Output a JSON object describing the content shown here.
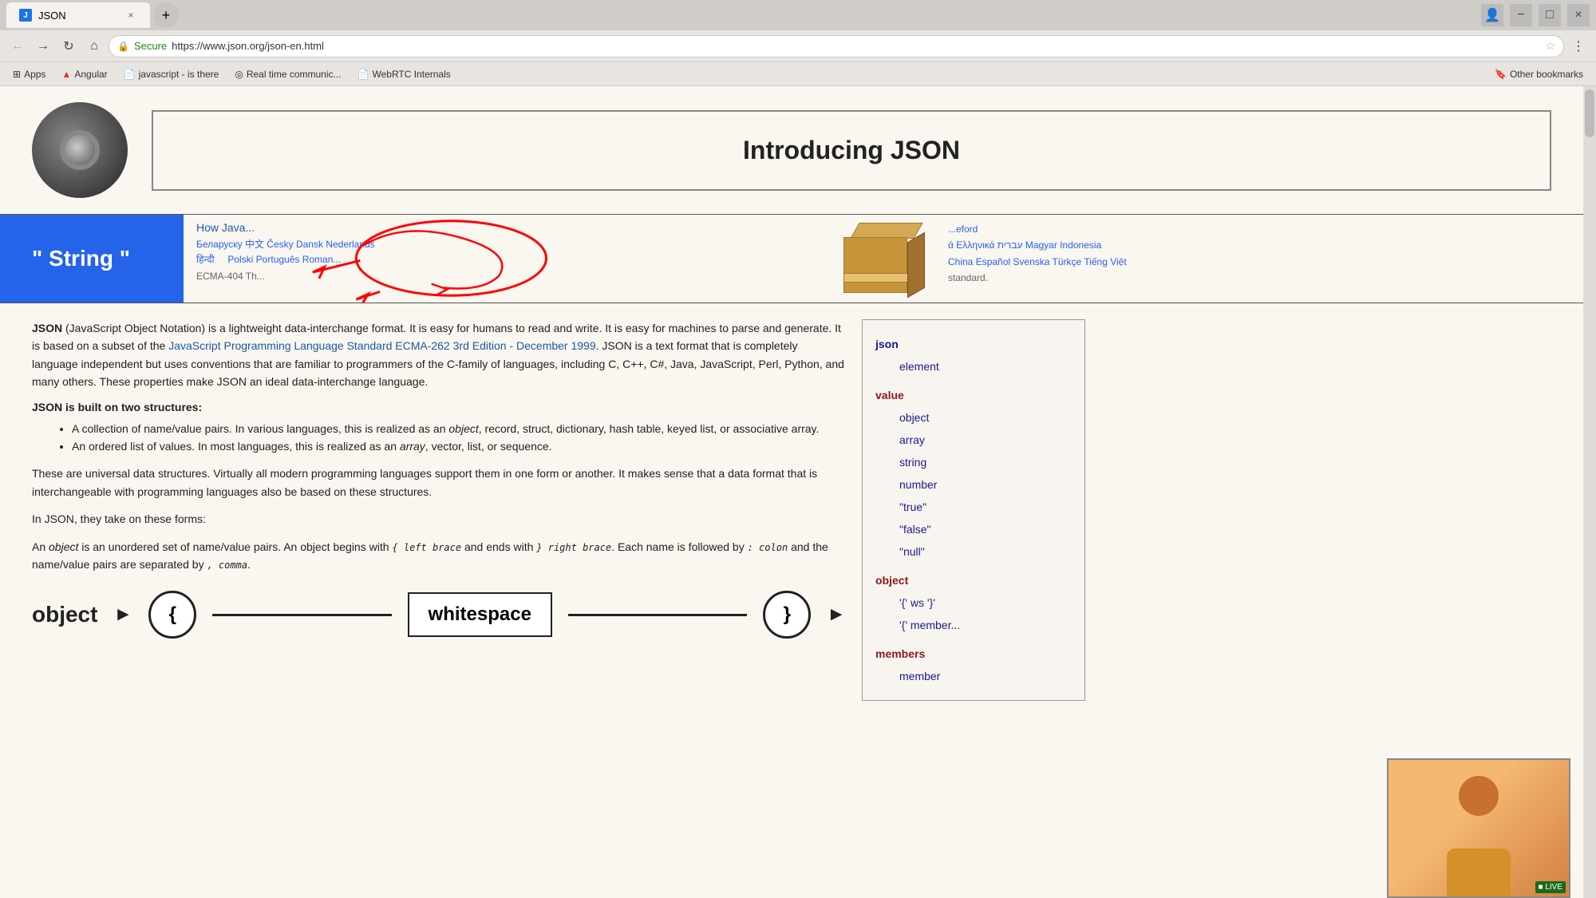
{
  "browser": {
    "tab": {
      "label": "JSON",
      "favicon": "J",
      "close_icon": "×"
    },
    "new_tab_icon": "+",
    "window_controls": {
      "profile_icon": "👤",
      "minimize": "−",
      "maximize": "□",
      "close": "×"
    }
  },
  "navbar": {
    "back_icon": "←",
    "forward_icon": "→",
    "refresh_icon": "↻",
    "home_icon": "⌂",
    "secure_label": "Secure",
    "url": "https://www.json.org/json-en.html",
    "star_icon": "☆",
    "account_icon": "⋮"
  },
  "bookmarks": {
    "items": [
      {
        "label": "Apps",
        "icon": "⊞"
      },
      {
        "label": "Angular",
        "icon": "▲"
      },
      {
        "label": "javascript - is there",
        "icon": "📄"
      },
      {
        "label": "Real time communic...",
        "icon": "◎"
      },
      {
        "label": "WebRTC Internals",
        "icon": "📄"
      }
    ],
    "other_bookmarks": "Other bookmarks"
  },
  "page": {
    "logo_alt": "JSON logo",
    "title": "Introducing JSON",
    "string_label": "\" String \"",
    "nav_links": {
      "how_java": "How Java...",
      "languages": "Беларуску 中文 Česky Dansk Nederlands\nहिन्दी ( Polski Português Roman...",
      "languages_right": "ά Ελληνικά עברית Magyar Indonesia\nChina Español Svenska Türkçe Tiếng Việt",
      "right_end": "...eford",
      "ecma": "ECMA-404 Th...",
      "standard": "standard."
    },
    "intro": {
      "paragraph1": "JSON (JavaScript Object Notation) is a lightweight data-interchange format. It is easy for humans to read and write. It is easy for machines to parse and generate. It is based on a subset of the JavaScript Programming Language Standard ECMA-262 3rd Edition - December 1999. JSON is a text format that is completely language independent but uses conventions that are familiar to programmers of the C-family of languages, including C, C++, C#, Java, JavaScript, Perl, Python, and many others. These properties make JSON an ideal data-interchange language.",
      "ecma_link": "JavaScript Programming Language Standard ECMA-262 3rd Edition - December 1999",
      "paragraph2": "JSON is built on two structures:",
      "structure1": "A collection of name/value pairs. In various languages, this is realized as an object, record, struct, dictionary, hash table, keyed list, or associative array.",
      "structure2": "An ordered list of values. In most languages, this is realized as an array, vector, list, or sequence.",
      "paragraph3": "These are universal data structures. Virtually all modern programming languages support them in one form or another. It makes sense that a data format that is interchangeable with programming languages also be based on these structures.",
      "paragraph4": "In JSON, they take on these forms:",
      "paragraph5_prefix": "An object is an unordered set of name/value pairs. An object begins with { left brace and ends with } right brace. Each name is followed by : colon and the name/value pairs are separated by , comma.",
      "object_italic": "object",
      "left_brace_label": "left brace",
      "right_brace_label": "right brace",
      "colon_label": "colon",
      "comma_label": "comma"
    },
    "diagram": {
      "label": "object",
      "open_brace": "{",
      "whitespace": "whitespace",
      "close_brace": "}",
      "arrow_right": "►"
    },
    "sidebar": {
      "json": "json",
      "element": "element",
      "value": "value",
      "object": "object",
      "array": "array",
      "string": "string",
      "number": "number",
      "true": "\"true\"",
      "false": "\"false\"",
      "null": "\"null\"",
      "object2": "object",
      "ws1": "'{' ws '}'",
      "ws2": "'{' member...",
      "members": "members",
      "member": "member"
    },
    "video": {
      "status": "■ LIVE"
    }
  }
}
